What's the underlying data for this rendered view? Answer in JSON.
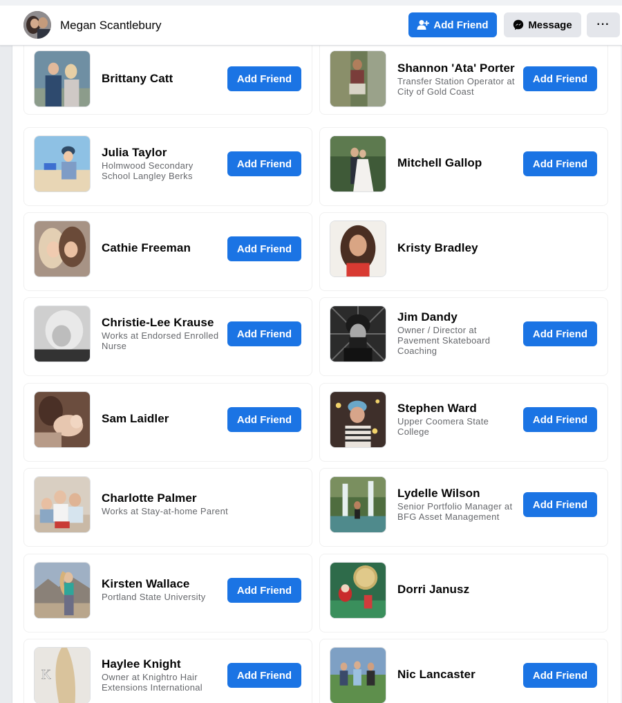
{
  "profile": {
    "name": "Megan Scantlebury",
    "add_friend_label": "Add Friend",
    "message_label": "Message",
    "more_label": "···"
  },
  "colors": {
    "accent": "#1b74e4",
    "secondary_button": "#e4e6eb",
    "text_primary": "#050505",
    "text_secondary": "#65676b"
  },
  "friends": [
    {
      "name": "Brittany Catt",
      "subtitle": "",
      "button": "Add Friend"
    },
    {
      "name": "Shannon 'Ata' Porter",
      "subtitle": "Transfer Station Operator at City of Gold Coast",
      "button": "Add Friend"
    },
    {
      "name": "Julia Taylor",
      "subtitle": "Holmwood Secondary School Langley Berks",
      "button": "Add Friend"
    },
    {
      "name": "Mitchell Gallop",
      "subtitle": "",
      "button": "Add Friend"
    },
    {
      "name": "Cathie Freeman",
      "subtitle": "",
      "button": "Add Friend"
    },
    {
      "name": "Kristy Bradley",
      "subtitle": "",
      "button": ""
    },
    {
      "name": "Christie-Lee Krause",
      "subtitle": "Works at Endorsed Enrolled Nurse",
      "button": "Add Friend"
    },
    {
      "name": "Jim Dandy",
      "subtitle": "Owner / Director at Pavement Skateboard Coaching",
      "button": "Add Friend"
    },
    {
      "name": "Sam Laidler",
      "subtitle": "",
      "button": "Add Friend"
    },
    {
      "name": "Stephen Ward",
      "subtitle": "Upper Coomera State College",
      "button": "Add Friend"
    },
    {
      "name": "Charlotte Palmer",
      "subtitle": "Works at Stay-at-home Parent",
      "button": ""
    },
    {
      "name": "Lydelle Wilson",
      "subtitle": "Senior Portfolio Manager at BFG Asset Management",
      "button": "Add Friend"
    },
    {
      "name": "Kirsten Wallace",
      "subtitle": "Portland State University",
      "button": "Add Friend"
    },
    {
      "name": "Dorri Janusz",
      "subtitle": "",
      "button": ""
    },
    {
      "name": "Haylee Knight",
      "subtitle": "Owner at Knightro Hair Extensions International",
      "button": "Add Friend"
    },
    {
      "name": "Nic Lancaster",
      "subtitle": "",
      "button": "Add Friend"
    }
  ]
}
